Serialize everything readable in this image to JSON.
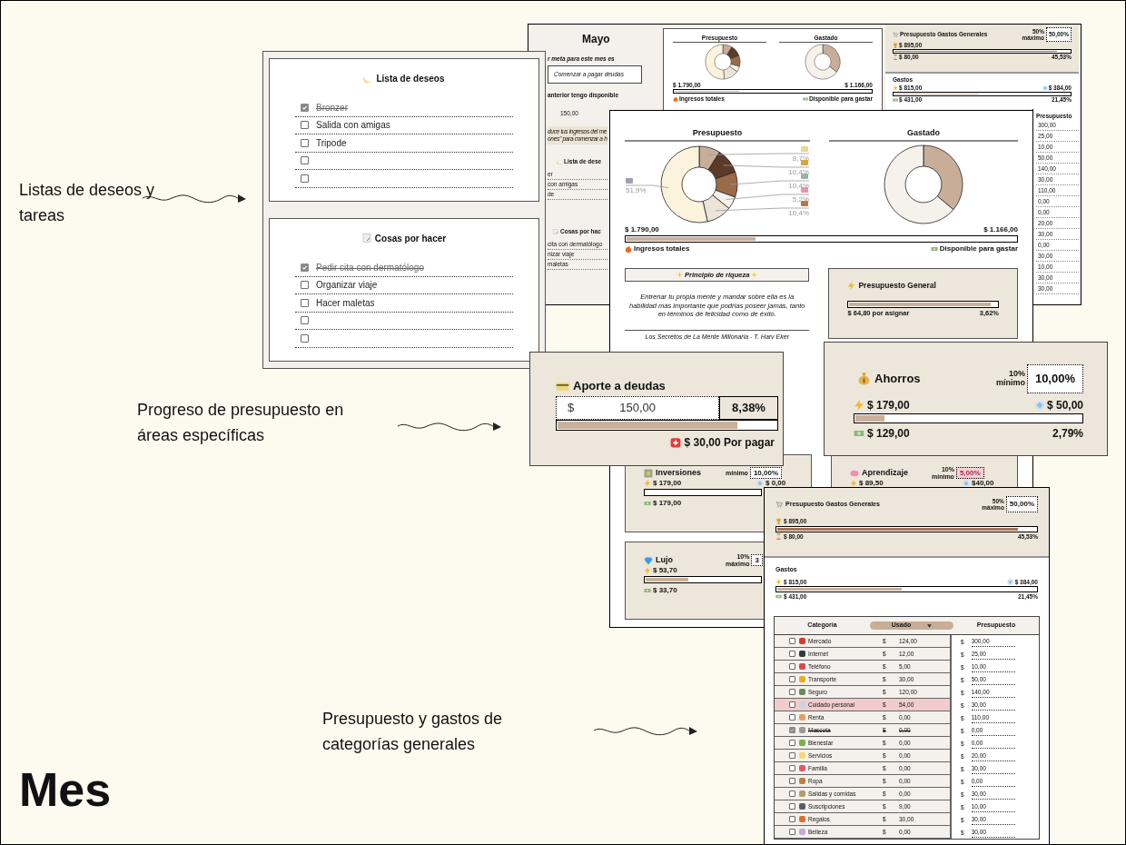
{
  "title": "Mes",
  "annotations": [
    {
      "text": "Listas de deseos y tareas"
    },
    {
      "text": "Progreso de presupuesto en áreas específicas"
    },
    {
      "text": "Presupuesto y gastos de categorías generales"
    }
  ],
  "back_sheet": {
    "month": "Mayo",
    "goal": {
      "label": "r meta para este mes es",
      "value": "Comenzar a pagar deudas"
    },
    "carry": {
      "label": "anterior tengo disponible",
      "value": "150,00"
    },
    "note": [
      "duce tus ingresos del me",
      "ones\" para comenzar a h"
    ],
    "wish_fragment": {
      "title": "Lista de dese",
      "items": [
        "er",
        "con amigas",
        "de"
      ]
    },
    "task_fragment": {
      "title": "Cosas por hac",
      "items": [
        "cita con dermatólogo",
        "nizar viaje",
        "maletas"
      ]
    },
    "summary": {
      "budget_title": "Presupuesto",
      "spent_title": "Gastado",
      "income": "$ 1.790,00",
      "available": "$ 1.166,00",
      "level": 0.33,
      "income_label": "Ingresos totales",
      "available_label": "Disponible para gastar"
    },
    "general": {
      "title": "Presupuesto Gastos Generales",
      "limit": "50%",
      "limit_label": "máximo",
      "share": "50,00%",
      "goal": "$ 895,00",
      "level": 0.93,
      "used": "$ 80,00",
      "percent": "45,53%"
    },
    "expenses": {
      "title": "Gastos",
      "spent": "$ 815,00",
      "left": "$ 384,00",
      "level": 0.48,
      "available": "$ 431,00",
      "percent": "21,45%"
    },
    "budget_column": {
      "header": "Presupuesto",
      "values": [
        "300,00",
        "25,00",
        "10,00",
        "50,00",
        "140,00",
        "30,00",
        "110,00",
        "0,00",
        "0,00",
        "20,00",
        "30,00",
        "0,00",
        "30,00",
        "10,00",
        "30,00",
        "30,00"
      ]
    }
  },
  "lists": [
    {
      "title": "Lista de deseos",
      "kind": "wish",
      "items": [
        {
          "text": "Bronzer",
          "checked": true
        },
        {
          "text": "Salida con amigas",
          "checked": false
        },
        {
          "text": "Tripode",
          "checked": false
        },
        {
          "checked": false
        },
        {
          "checked": false
        }
      ]
    },
    {
      "title": "Cosas por hacer",
      "kind": "todo",
      "items": [
        {
          "text": "Pedir cita con dermatólogo",
          "checked": true
        },
        {
          "text": "Organizar viaje",
          "checked": false
        },
        {
          "text": "Hacer maletas",
          "checked": false
        },
        {
          "checked": false
        },
        {
          "checked": false
        }
      ]
    }
  ],
  "dashboard": {
    "budget_chart": {
      "title": "Presupuesto",
      "chart_data": {
        "type": "donut",
        "values": [
          8.7,
          10.4,
          10.4,
          5.2,
          10.4,
          51.9
        ],
        "value_labels": [
          "8,7%",
          "10,4%",
          "10,4%",
          "5,2%",
          "10,4%",
          "51,9%"
        ]
      }
    },
    "spent_chart": {
      "title": "Gastado"
    },
    "income": "$ 1.790,00",
    "available": "$ 1.166,00",
    "level": 0.33,
    "income_label": "Ingresos totales",
    "available_label": "Disponible para gastar",
    "quote": {
      "title": "Principio de riqueza",
      "text": "Entrenar tu propia mente y mandar sobre ella es la habilidad más importante que podrías poseer jamás, tanto en términos de felicidad como de éxito.",
      "source": "Los Secretos de La Mente Millonaria -  T. Harv Eker"
    },
    "general_budget": {
      "title": "Presupuesto General",
      "level": 0.96,
      "unassigned": "$ 64,80 por asignar",
      "percent": "3,62%"
    },
    "areas": [
      {
        "title": "Inversiones",
        "kind": "safe",
        "limit_label": "mínimo",
        "share": "10,00%",
        "flagged": false,
        "budget": "$ 179,00",
        "saved": "$ 0,00",
        "level": 0,
        "left": "$ 179,00"
      },
      {
        "title": "Aprendizaje",
        "kind": "brain",
        "limit": "10%",
        "limit_label": "mínimo",
        "share": "5,00%",
        "flagged": true,
        "budget": "$ 89,50",
        "saved": "$40,00"
      },
      {
        "title": "Lujo",
        "kind": "diamond",
        "limit": "10%",
        "limit_label": "máximo",
        "share": "3",
        "flagged": false,
        "budget": "$ 53,70",
        "level": 0.37,
        "left": "$ 33,70"
      }
    ]
  },
  "debt_card": {
    "title": "Aporte a deudas",
    "currency": "$",
    "amount": "150,00",
    "percent": "8,38%",
    "level": 0.82,
    "pending": "$ 30,00 Por pagar"
  },
  "savings_card": {
    "title": "Ahorros",
    "limit": "10%",
    "limit_label": "mínimo",
    "share": "10,00%",
    "budget": "$ 179,00",
    "saved": "$ 50,00",
    "level": 0.13,
    "left": "$ 129,00",
    "percent": "2,79%"
  },
  "categories": {
    "general": {
      "title": "Presupuesto Gastos Generales",
      "limit": "50%",
      "limit_label": "máximo",
      "share": "50,00%",
      "goal": "$ 895,00",
      "level": 0.93,
      "used": "$ 80,00",
      "percent": "45,53%"
    },
    "expenses": {
      "title": "Gastos",
      "spent": "$ 815,00",
      "left": "$ 384,00",
      "level": 0.48,
      "available": "$ 431,00",
      "percent": "21,45%"
    },
    "table": {
      "columns": [
        "Categoría",
        "Usado",
        "Presupuesto"
      ],
      "rows": [
        {
          "name": "Mercado",
          "used_symbol": "$",
          "used": "124,00",
          "budget_symbol": "$",
          "budget": "300,00",
          "checked": false,
          "over": false
        },
        {
          "name": "Internet",
          "used_symbol": "$",
          "used": "12,00",
          "budget_symbol": "$",
          "budget": "25,00",
          "checked": false,
          "over": false
        },
        {
          "name": "Teléfono",
          "used_symbol": "$",
          "used": "5,00",
          "budget_symbol": "$",
          "budget": "10,00",
          "checked": false,
          "over": false
        },
        {
          "name": "Transporte",
          "used_symbol": "$",
          "used": "30,00",
          "budget_symbol": "$",
          "budget": "50,00",
          "checked": false,
          "over": false
        },
        {
          "name": "Seguro",
          "used_symbol": "$",
          "used": "120,00",
          "budget_symbol": "$",
          "budget": "140,00",
          "checked": false,
          "over": false
        },
        {
          "name": "Cuidado personal",
          "used_symbol": "$",
          "used": "54,00",
          "budget_symbol": "$",
          "budget": "30,00",
          "checked": false,
          "over": true
        },
        {
          "name": "Renta",
          "used_symbol": "$",
          "used": "0,00",
          "budget_symbol": "$",
          "budget": "110,00",
          "checked": false,
          "over": false
        },
        {
          "name": "Mascota",
          "used_symbol": "$",
          "used": "0,00",
          "budget_symbol": "$",
          "budget": "0,00",
          "checked": true,
          "over": false
        },
        {
          "name": "Bienestar",
          "used_symbol": "$",
          "used": "0,00",
          "budget_symbol": "$",
          "budget": "0,00",
          "checked": false,
          "over": false
        },
        {
          "name": "Servicios",
          "used_symbol": "$",
          "used": "0,00",
          "budget_symbol": "$",
          "budget": "20,00",
          "checked": false,
          "over": false
        },
        {
          "name": "Familia",
          "used_symbol": "$",
          "used": "0,00",
          "budget_symbol": "$",
          "budget": "30,00",
          "checked": false,
          "over": false
        },
        {
          "name": "Ropa",
          "used_symbol": "$",
          "used": "0,00",
          "budget_symbol": "$",
          "budget": "0,00",
          "checked": false,
          "over": false
        },
        {
          "name": "Salidas y comidas",
          "used_symbol": "$",
          "used": "0,00",
          "budget_symbol": "$",
          "budget": "30,00",
          "checked": false,
          "over": false
        },
        {
          "name": "Suscripciones",
          "used_symbol": "$",
          "used": "9,00",
          "budget_symbol": "$",
          "budget": "10,00",
          "checked": false,
          "over": false
        },
        {
          "name": "Regalos",
          "used_symbol": "$",
          "used": "30,00",
          "budget_symbol": "$",
          "budget": "30,00",
          "checked": false,
          "over": false
        },
        {
          "name": "Belleza",
          "used_symbol": "$",
          "used": "0,00",
          "budget_symbol": "$",
          "budget": "30,00",
          "checked": false,
          "over": false
        }
      ]
    }
  }
}
